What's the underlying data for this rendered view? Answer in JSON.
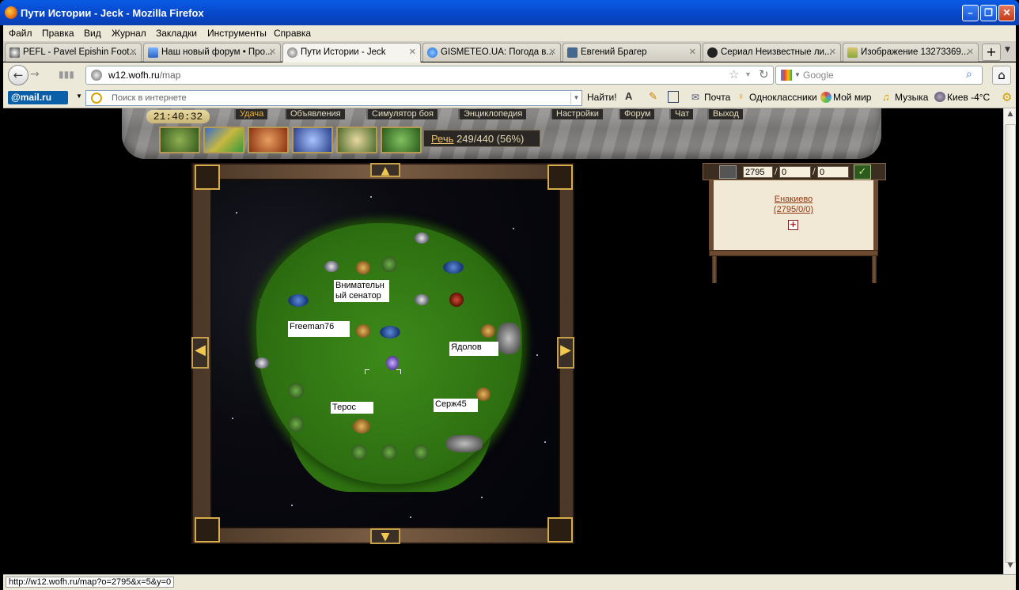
{
  "window": {
    "title": "Пути Истории - Jeck - Mozilla Firefox"
  },
  "menu": [
    "Файл",
    "Правка",
    "Вид",
    "Журнал",
    "Закладки",
    "Инструменты",
    "Справка"
  ],
  "tabs": [
    {
      "label": "PEFL - Pavel Epishin Foot...",
      "active": false
    },
    {
      "label": "Наш новый форум • Про...",
      "active": false
    },
    {
      "label": "Пути Истории - Jeck",
      "active": true
    },
    {
      "label": "GISMETEO.UA: Погода в...",
      "active": false
    },
    {
      "label": "Евгений Брагер",
      "active": false
    },
    {
      "label": "Сериал Неизвестные ли...",
      "active": false
    },
    {
      "label": "Изображение 13273369...",
      "active": false
    }
  ],
  "nav": {
    "url_host": "w12.wofh.ru",
    "url_path": "/map",
    "search_placeholder": "Google"
  },
  "mailbar": {
    "logo": "@mail.ru",
    "search_placeholder": "Поиск в интернете",
    "find": "Найти!",
    "links": [
      "Почта",
      "Одноклассники",
      "Мой мир",
      "Музыка",
      "Киев -4°C"
    ]
  },
  "game": {
    "clock": "21:40:32",
    "menu": [
      "Удача",
      "Объявления",
      "Симулятор боя",
      "Энциклопедия",
      "Настройки",
      "Форум",
      "Чат",
      "Выход"
    ],
    "speech_label": "Речь",
    "speech_value": "249/440 (56%)",
    "map_labels": [
      "Внимательн ый сенатор",
      "Freeman76",
      "Ядолов",
      "Терос",
      "Серж45"
    ],
    "coords": {
      "x": "2795",
      "y": "0",
      "z": "0"
    },
    "place": {
      "name": "Енакиево",
      "coords": "(2795/0/0)"
    }
  },
  "status": {
    "url": "http://w12.wofh.ru/map?o=2795&x=5&y=0"
  }
}
